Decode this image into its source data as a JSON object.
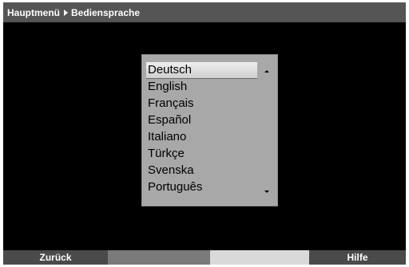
{
  "breadcrumb": {
    "parent": "Hauptmenü",
    "current": "Bediensprache"
  },
  "menu": {
    "items": [
      {
        "label": "Deutsch",
        "selected": true
      },
      {
        "label": "English",
        "selected": false
      },
      {
        "label": "Français",
        "selected": false
      },
      {
        "label": "Español",
        "selected": false
      },
      {
        "label": "Italiano",
        "selected": false
      },
      {
        "label": "Türkçe",
        "selected": false
      },
      {
        "label": "Svenska",
        "selected": false
      },
      {
        "label": "Português",
        "selected": false
      }
    ]
  },
  "bottom_bar": {
    "back_label": "Zurück",
    "help_label": "Hilfe"
  },
  "colors": {
    "background": "#000000",
    "header": "#555555",
    "menu_bg": "#a8a8a8",
    "selected_bg": "#e0e0e0"
  }
}
